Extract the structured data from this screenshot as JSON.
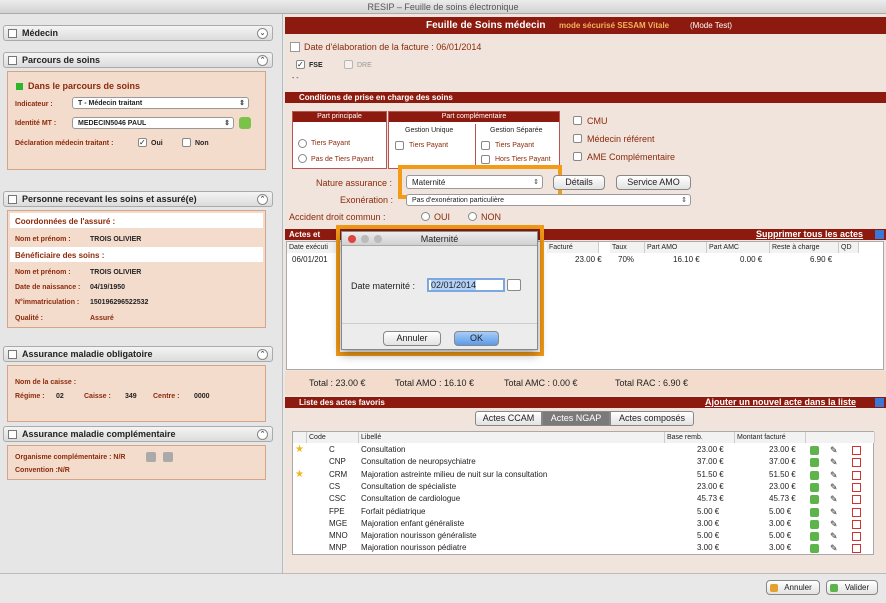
{
  "window": {
    "title": "RESIP – Feuille de soins électronique"
  },
  "left": {
    "medecin": {
      "title": "Médecin"
    },
    "parcours": {
      "title": "Parcours de soins",
      "status": "Dans le parcours de soins",
      "indicateur_label": "Indicateur :",
      "indicateur_value": "T - Médecin traitant",
      "identite_label": "Identité MT :",
      "identite_value": "MEDECIN5046 PAUL",
      "declaration_label": "Déclaration médecin traitant :",
      "oui": "Oui",
      "non": "Non"
    },
    "personne": {
      "title": "Personne recevant les soins et assuré(e)",
      "coord_title": "Coordonnées de l'assuré :",
      "nom_label": "Nom et prénom :",
      "nom_value": "TROIS OLIVIER",
      "benef_title": "Bénéficiaire des soins :",
      "nom2_label": "Nom et prénom :",
      "nom2_value": "TROIS OLIVIER",
      "naissance_label": "Date de naissance :",
      "naissance_value": "04/19/1950",
      "immat_label": "N°immatriculation :",
      "immat_value": "150196296522532",
      "qualite_label": "Qualité :",
      "qualite_value": "Assuré"
    },
    "amo": {
      "title": "Assurance maladie obligatoire",
      "caisse_label": "Nom de la caisse :",
      "regime_label": "Régime :",
      "regime_value": "02",
      "caisse2_label": "Caisse :",
      "caisse2_value": "349",
      "centre_label": "Centre :",
      "centre_value": "0000"
    },
    "amc": {
      "title": "Assurance maladie complémentaire",
      "org_label": "Organisme complémentaire : N/R",
      "conv_label": "Convention :N/R"
    }
  },
  "header": {
    "title": "Feuille de Soins médecin",
    "mode": "mode sécurisé SESAM Vitale",
    "test": "(Mode Test)"
  },
  "facture": {
    "date_label": "Date d'élaboration de la facture : 06/01/2014",
    "fse": "FSE",
    "dre": "DRE",
    "dash": "- -"
  },
  "conditions": {
    "title": "Conditions de prise en charge des soins",
    "part_principale": "Part principale",
    "part_complementaire": "Part complémentaire",
    "gestion_unique": "Gestion Unique",
    "gestion_separee": "Gestion Séparée",
    "tiers_payant": "Tiers Payant",
    "pas_tiers_payant": "Pas de Tiers Payant",
    "tiers_payant2": "Tiers Payant",
    "tiers_payant3": "Tiers Payant",
    "hors_tiers_payant": "Hors Tiers Payant",
    "cmu": "CMU",
    "medecin_referent": "Médecin référent",
    "ame": "AME Complémentaire",
    "nature_label": "Nature assurance :",
    "nature_value": "Maternité",
    "details": "Détails",
    "service_amo": "Service AMO",
    "exoneration_label": "Exonération :",
    "exoneration_value": "Pas d'exonération particulière",
    "accident_label": "Accident droit commun :",
    "oui": "OUI",
    "non": "NON"
  },
  "actes": {
    "title": "Actes et",
    "delete_all": "Supprimer tous les actes",
    "columns": [
      "Date exécuti",
      "Facturé",
      "Taux",
      "Part AMO",
      "Part AMC",
      "Reste à charge",
      "QD"
    ],
    "rows": [
      {
        "date": "06/01/201",
        "facture": "23.00 €",
        "taux": "70%",
        "amo": "16.10 €",
        "amc": "0.00 €",
        "reste": "6.90 €"
      }
    ],
    "total": "Total : 23.00 €",
    "total_amo": "Total AMO : 16.10 €",
    "total_amc": "Total AMC : 0.00 €",
    "total_rac": "Total RAC : 6.90 €"
  },
  "favoris": {
    "title": "Liste des actes favoris",
    "add_link": "Ajouter un nouvel acte dans la liste",
    "tabs": [
      "Actes CCAM",
      "Actes NGAP",
      "Actes composés"
    ],
    "columns": [
      "Code",
      "Libellé",
      "Base remb.",
      "Montant facturé"
    ],
    "rows": [
      {
        "code": "C",
        "libelle": "Consultation",
        "base": "23.00 €",
        "montant": "23.00 €",
        "star": true
      },
      {
        "code": "CNP",
        "libelle": "Consultation de neuropsychiatre",
        "base": "37.00 €",
        "montant": "37.00 €",
        "star": false
      },
      {
        "code": "CRM",
        "libelle": "Majoration astreinte milieu de nuit sur la consultation",
        "base": "51.50 €",
        "montant": "51.50 €",
        "star": true
      },
      {
        "code": "CS",
        "libelle": "Consultation de spécialiste",
        "base": "23.00 €",
        "montant": "23.00 €",
        "star": false
      },
      {
        "code": "CSC",
        "libelle": "Consultation de cardiologue",
        "base": "45.73 €",
        "montant": "45.73 €",
        "star": false
      },
      {
        "code": "FPE",
        "libelle": "Forfait pédiatrique",
        "base": "5.00 €",
        "montant": "5.00 €",
        "star": false
      },
      {
        "code": "MGE",
        "libelle": "Majoration enfant généraliste",
        "base": "3.00 €",
        "montant": "3.00 €",
        "star": false
      },
      {
        "code": "MNO",
        "libelle": "Majoration nourisson généraliste",
        "base": "5.00 €",
        "montant": "5.00 €",
        "star": false
      },
      {
        "code": "MNP",
        "libelle": "Majoration nourisson pédiatre",
        "base": "3.00 €",
        "montant": "3.00 €",
        "star": false
      }
    ]
  },
  "dialog": {
    "title": "Maternité",
    "date_label": "Date maternité :",
    "date_value": "02/01/2014",
    "cancel": "Annuler",
    "ok": "OK"
  },
  "footer": {
    "cancel": "Annuler",
    "validate": "Valider"
  }
}
